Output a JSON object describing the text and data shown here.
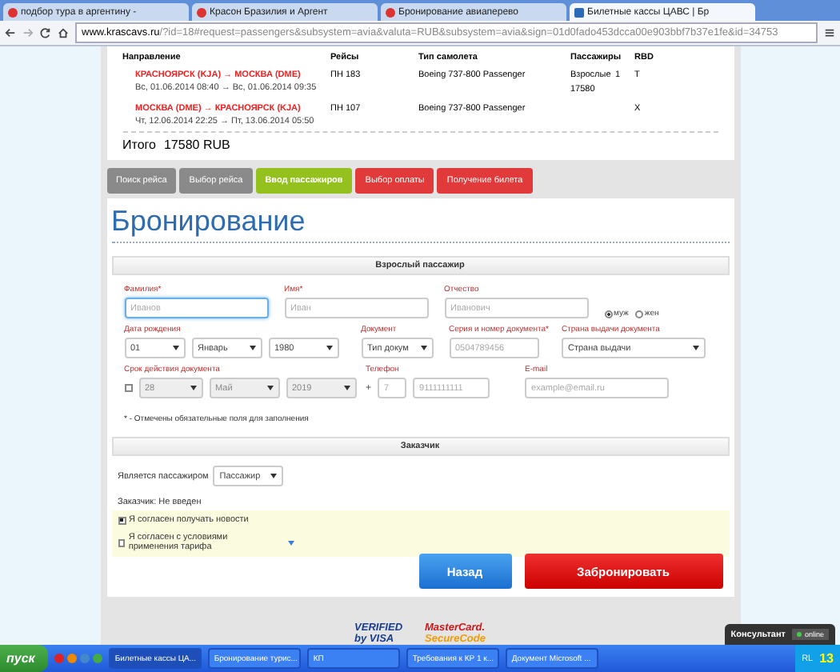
{
  "browser": {
    "tabs": [
      {
        "title": "подбор тура в аргентину -",
        "selected": false
      },
      {
        "title": "Красон Бразилия и Аргент",
        "selected": false
      },
      {
        "title": "Бронирование авиаперево",
        "selected": false
      },
      {
        "title": "Билетные кассы ЦАВС | Бр",
        "selected": true
      }
    ],
    "address": {
      "host": "www.krascavs.ru",
      "rest": "/?id=18#request=passengers&subsystem=avia&valuta=RUB&subsystem=avia&sign=01d0fado453dcca00e903bbf7b37e1fe&id=34753"
    }
  },
  "flights": {
    "columns": [
      "Направление",
      "Рейсы",
      "Тип самолета",
      "Пассажиры",
      "RBD"
    ],
    "rows": [
      {
        "route": "КРАСНОЯРСК (KJA) → МОСКВА (DME)",
        "dates": "Вс, 01.06.2014 08:40 → Вс, 01.06.2014 09:35",
        "flight": "ПН 183",
        "aircraft": "Boeing 737-800 Passenger",
        "passengers": {
          "type": "Взрослые",
          "count": "1",
          "price": "17580"
        },
        "rbd": "Т"
      },
      {
        "route": "МОСКВА (DME) → КРАСНОЯРСК (KJA)",
        "dates": "Чт, 12.06.2014 22:25 → Пт, 13.06.2014 05:50",
        "flight": "ПН 107",
        "aircraft": "Boeing 737-800 Passenger",
        "rbd": "Х"
      }
    ],
    "total": {
      "label": "Итого",
      "value": "17580 RUB"
    }
  },
  "steps": [
    {
      "label": "Поиск рейса",
      "selected": false,
      "completed": true
    },
    {
      "label": "Выбор рейса",
      "selected": false,
      "completed": true
    },
    {
      "label": "Ввод пассажиров",
      "selected": true,
      "completed": false
    },
    {
      "label": "Выбор оплаты",
      "selected": false,
      "completed": false
    },
    {
      "label": "Получение билета",
      "selected": false,
      "completed": false
    }
  ],
  "heading": "Бронирование",
  "passenger": {
    "title": "Взрослый пассажир",
    "rows": [
      [
        {
          "label": "Фамилия*",
          "controls": [
            {
              "kind": "input",
              "placeholder": "Иванов",
              "focused": true
            }
          ]
        },
        {
          "label": "Имя*",
          "controls": [
            {
              "kind": "input",
              "placeholder": "Иван",
              "focused": false
            }
          ]
        },
        {
          "label": "Отчество",
          "controls": [
            {
              "kind": "input",
              "placeholder": "Иванович",
              "focused": false
            }
          ]
        },
        {
          "controls": [
            {
              "kind": "radio",
              "label": "муж",
              "selected": true
            },
            {
              "kind": "radio",
              "label": "жен",
              "selected": false
            }
          ]
        }
      ],
      [
        {
          "label": "Дата рождения",
          "controls": [
            {
              "kind": "select",
              "value": "01",
              "disabled": false
            },
            {
              "kind": "select",
              "value": "Январь",
              "disabled": false
            },
            {
              "kind": "select",
              "value": "1980",
              "disabled": false
            }
          ]
        },
        {
          "label": "Документ",
          "controls": [
            {
              "kind": "select",
              "value": "Тип докум",
              "disabled": false
            }
          ]
        },
        {
          "label": "Серия и номер документа*",
          "controls": [
            {
              "kind": "input",
              "placeholder": "0504789456",
              "focused": false
            }
          ]
        },
        {
          "label": "Страна выдачи документа",
          "controls": [
            {
              "kind": "select",
              "value": "Страна выдачи",
              "disabled": false
            }
          ]
        }
      ],
      [
        {
          "label": "Срок действия документа",
          "controls": [
            {
              "kind": "checkbox",
              "checked": false
            },
            {
              "kind": "select",
              "value": "28",
              "disabled": true
            },
            {
              "kind": "select",
              "value": "Май",
              "disabled": true
            },
            {
              "kind": "select",
              "value": "2019",
              "disabled": true
            }
          ]
        },
        {
          "label": "Телефон",
          "controls": [
            {
              "kind": "text",
              "text": "+"
            },
            {
              "kind": "input",
              "placeholder": "7",
              "focused": false
            },
            {
              "kind": "input",
              "placeholder": "9111111111",
              "focused": false
            }
          ]
        },
        {
          "label": "E-mail",
          "controls": [
            {
              "kind": "input",
              "placeholder": "example@email.ru",
              "focused": false
            }
          ]
        }
      ]
    ],
    "note": "* - Отмечены обязательные поля для заполнения"
  },
  "customer": {
    "title": "Заказчик",
    "is_passenger_label": "Является пассажиром",
    "is_passenger_value": "Пассажир",
    "status": "Заказчик: Не введен",
    "agreements": [
      {
        "label": "Я согласен получать новости",
        "checked": true
      },
      {
        "label": "Я согласен с условиями применения тарифа",
        "checked": false
      }
    ]
  },
  "buttons": [
    {
      "label": "Назад",
      "kind": "back"
    },
    {
      "label": "Забронировать",
      "kind": "primary"
    }
  ],
  "footer_logos": [
    {
      "line1": "VERIFIED",
      "line2": "by VISA",
      "kind": "visa"
    },
    {
      "line1": "MasterCard.",
      "line2": "SecureCode",
      "kind": "mastercard"
    }
  ],
  "chat": {
    "label": "Консультант",
    "status": "online"
  },
  "taskbar": {
    "start": "пуск",
    "tasks": [
      {
        "title": "Билетные кассы ЦА...",
        "selected": true
      },
      {
        "title": "Бронирование турис...",
        "selected": false
      },
      {
        "title": "КП",
        "selected": false
      },
      {
        "title": "Требования к КР 1 к...",
        "selected": false
      },
      {
        "title": "Документ Microsoft ...",
        "selected": false
      }
    ],
    "lang": "RL",
    "clock": "13"
  }
}
